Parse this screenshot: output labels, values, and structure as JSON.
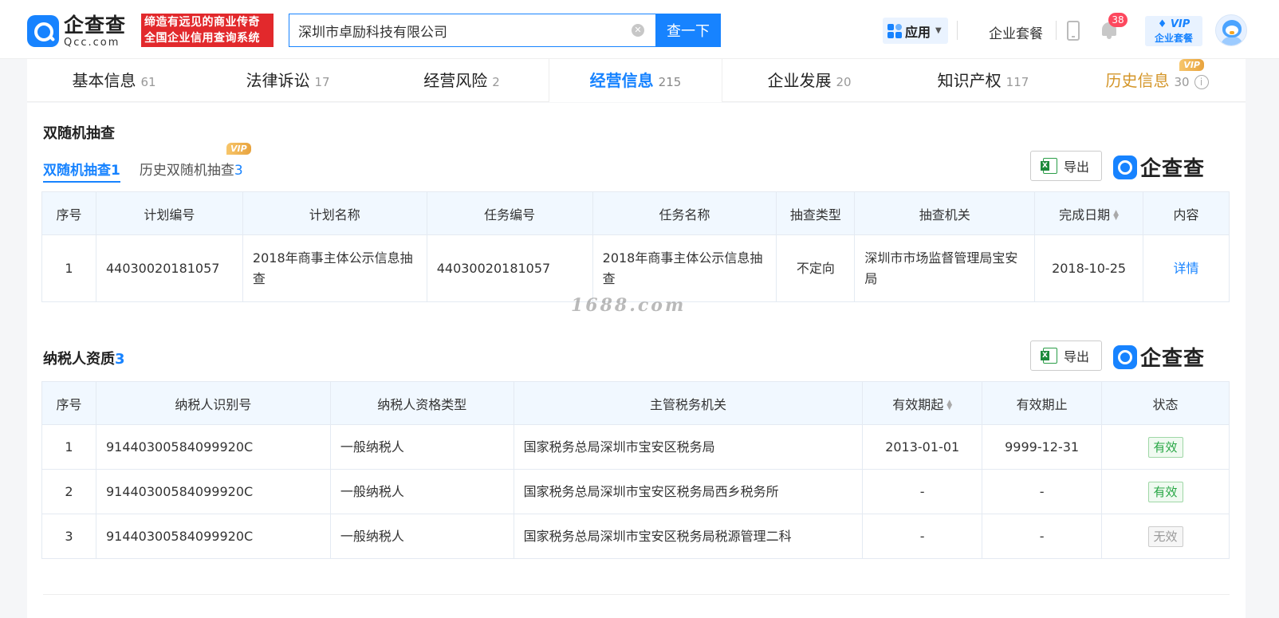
{
  "header": {
    "logo_cn": "企查查",
    "logo_en": "Qcc.com",
    "slogan_line1": "缔造有远见的商业传奇",
    "slogan_line2": "全国企业信用查询系统",
    "search_value": "深圳市卓励科技有限公司",
    "search_button": "查一下",
    "apps_label": "应用",
    "enterprise_package": "企业套餐",
    "notification_count": "38",
    "vip_label": "VIP",
    "vip_sub": "企业套餐"
  },
  "tabs": [
    {
      "label": "基本信息",
      "count": "61"
    },
    {
      "label": "法律诉讼",
      "count": "17"
    },
    {
      "label": "经营风险",
      "count": "2"
    },
    {
      "label": "经营信息",
      "count": "215"
    },
    {
      "label": "企业发展",
      "count": "20"
    },
    {
      "label": "知识产权",
      "count": "117"
    },
    {
      "label": "历史信息",
      "count": "30",
      "tag": "VIP"
    }
  ],
  "random_check": {
    "title": "双随机抽查",
    "subtabs": [
      {
        "label": "双随机抽查",
        "count": "1"
      },
      {
        "label": "历史双随机抽查",
        "count": "3",
        "tag": "VIP"
      }
    ],
    "export_label": "导出",
    "brand": "企查查",
    "columns": [
      "序号",
      "计划编号",
      "计划名称",
      "任务编号",
      "任务名称",
      "抽查类型",
      "抽查机关",
      "完成日期",
      "内容"
    ],
    "rows": [
      {
        "no": "1",
        "plan_no": "44030020181057",
        "plan_name": "2018年商事主体公示信息抽查",
        "task_no": "44030020181057",
        "task_name": "2018年商事主体公示信息抽查",
        "check_type": "不定向",
        "authority": "深圳市市场监督管理局宝安局",
        "date": "2018-10-25",
        "content": "详情"
      }
    ]
  },
  "watermark": "1688.com",
  "taxpayer": {
    "title": "纳税人资质",
    "count": "3",
    "export_label": "导出",
    "brand": "企查查",
    "columns": [
      "序号",
      "纳税人识别号",
      "纳税人资格类型",
      "主管税务机关",
      "有效期起",
      "有效期止",
      "状态"
    ],
    "rows": [
      {
        "no": "1",
        "id": "91440300584099920C",
        "type": "一般纳税人",
        "authority": "国家税务总局深圳市宝安区税务局",
        "start": "2013-01-01",
        "end": "9999-12-31",
        "status": "有效"
      },
      {
        "no": "2",
        "id": "91440300584099920C",
        "type": "一般纳税人",
        "authority": "国家税务总局深圳市宝安区税务局西乡税务所",
        "start": "-",
        "end": "-",
        "status": "有效"
      },
      {
        "no": "3",
        "id": "91440300584099920C",
        "type": "一般纳税人",
        "authority": "国家税务总局深圳市宝安区税务局税源管理二科",
        "start": "-",
        "end": "-",
        "status": "无效"
      }
    ]
  },
  "colors": {
    "accent": "#1783ff",
    "slogan_bg": "#e2292c",
    "valid": "#28a745",
    "history_tab": "#d4962a"
  }
}
